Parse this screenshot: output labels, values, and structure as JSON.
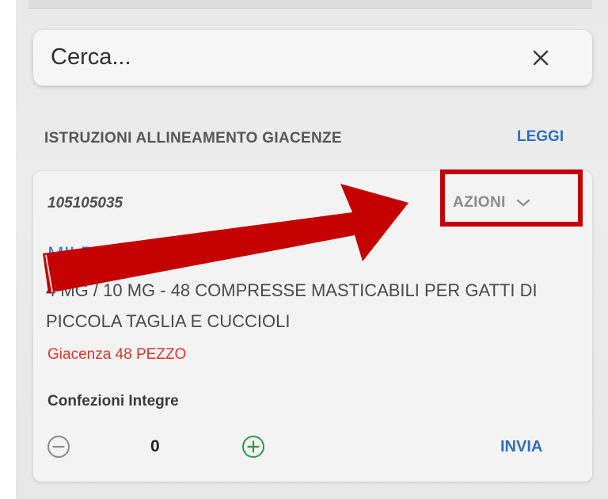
{
  "search": {
    "placeholder": "Cerca..."
  },
  "section": {
    "title": "ISTRUZIONI ALLINEAMENTO GIACENZE",
    "read_label": "LEGGI"
  },
  "card": {
    "code": "105105035",
    "actions_label": "AZIONI",
    "product_name": "MILBEMAX VET",
    "description": "4 MG / 10 MG - 48 COMPRESSE MASTICABILI PER GATTI DI PICCOLA TAGLIA E CUCCIOLI",
    "stock": "Giacenza 48 PEZZO",
    "packages_label": "Confezioni Integre",
    "quantity": "0",
    "send_label": "INVIA"
  },
  "colors": {
    "link_blue": "#2d6ec3",
    "stock_red": "#e1332a",
    "increment_green": "#2c9a43",
    "annotation_red": "#c40000"
  },
  "icons": {
    "close": "close-icon",
    "chevron": "chevron-down-icon",
    "minus": "minus-circle-icon",
    "plus": "plus-circle-icon"
  },
  "annotation": {
    "type": "arrow-and-highlight-box",
    "target": "AZIONI"
  }
}
